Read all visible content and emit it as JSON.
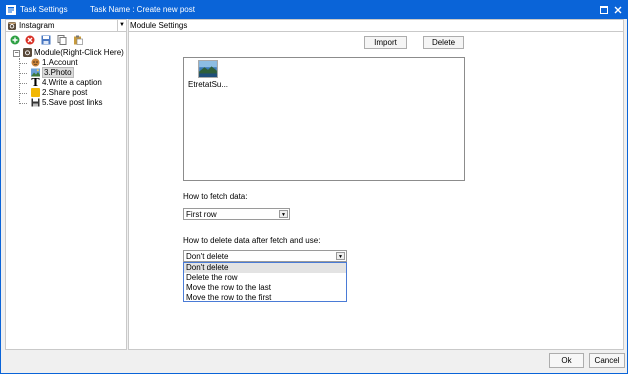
{
  "window": {
    "title": "Task Settings",
    "task_name": "Task Name : Create new post"
  },
  "left_panel": {
    "combo_label": "Instagram",
    "toolbar": [
      "add-icon",
      "delete-icon",
      "save-icon",
      "copy-icon",
      "paste-icon"
    ],
    "tree": {
      "root": "Module(Right-Click Here)",
      "items": [
        {
          "label": "1.Account",
          "icon": "account-icon",
          "selected": false
        },
        {
          "label": "3.Photo",
          "icon": "photo-icon",
          "selected": true
        },
        {
          "label": "4.Write a caption",
          "icon": "text-icon",
          "selected": false
        },
        {
          "label": "2.Share post",
          "icon": "share-icon",
          "selected": false
        },
        {
          "label": "5.Save post links",
          "icon": "floppy-icon",
          "selected": false
        }
      ]
    }
  },
  "right_panel": {
    "header": "Module Settings",
    "import_label": "Import",
    "delete_label": "Delete",
    "file": {
      "name": "EtretatSu..."
    },
    "fetch": {
      "label": "How to fetch data:",
      "value": "First row"
    },
    "delete_after": {
      "label": "How to delete data after fetch and use:",
      "value": "Don't delete",
      "options": [
        {
          "label": "Don't delete",
          "highlighted": true
        },
        {
          "label": "Delete the row",
          "highlighted": false
        },
        {
          "label": "Move the row to the last",
          "highlighted": false
        },
        {
          "label": "Move the row to the first",
          "highlighted": false
        }
      ]
    }
  },
  "footer": {
    "ok_label": "Ok",
    "cancel_label": "Cancel"
  },
  "colors": {
    "titlebar": "#0a64d8",
    "dropdown_border": "#4a7bd6"
  }
}
